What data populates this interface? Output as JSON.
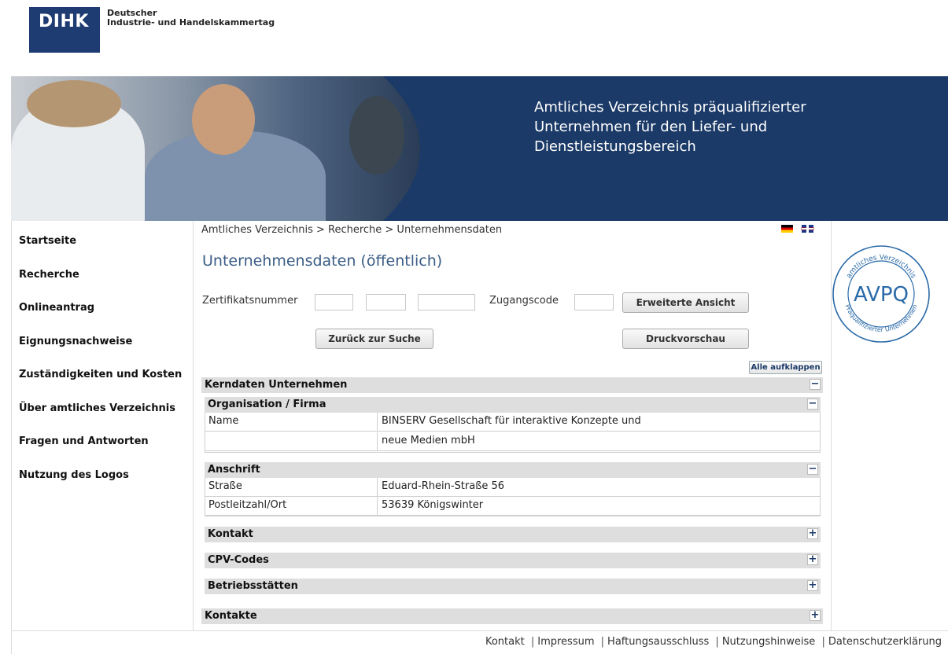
{
  "header": {
    "logo_text": "DIHK",
    "org_line1": "Deutscher",
    "org_line2": "Industrie- und Handelskammertag"
  },
  "banner": {
    "line1": "Amtliches Verzeichnis präqualifizierter",
    "line2": "Unternehmen für den Liefer- und",
    "line3": "Dienstleistungsbereich"
  },
  "nav": [
    {
      "label": "Startseite"
    },
    {
      "label": "Recherche"
    },
    {
      "label": "Onlineantrag"
    },
    {
      "label": "Eignungsnachweise"
    },
    {
      "label": "Zuständigkeiten und Kosten"
    },
    {
      "label": "Über amtliches Verzeichnis"
    },
    {
      "label": "Fragen und Antworten"
    },
    {
      "label": "Nutzung des Logos"
    }
  ],
  "breadcrumb": "Amtliches Verzeichnis > Recherche > Unternehmensdaten",
  "page_title": "Unternehmensdaten (öffentlich)",
  "form": {
    "cert_label": "Zertifikatsnummer",
    "access_label": "Zugangscode",
    "btn_extended": "Erweiterte Ansicht",
    "btn_back": "Zurück zur Suche",
    "btn_print": "Druckvorschau",
    "btn_expand_all": "Alle aufklappen"
  },
  "sections": {
    "kerndaten": "Kerndaten Unternehmen",
    "organisation": "Organisation / Firma",
    "anschrift": "Anschrift",
    "kontakt": "Kontakt",
    "cpv": "CPV-Codes",
    "betriebsstaetten": "Betriebsstätten",
    "kontakte": "Kontakte",
    "minus": "−",
    "plus": "+"
  },
  "organisation_rows": [
    {
      "key": "Name",
      "value": "BINSERV Gesellschaft für interaktive Konzepte und"
    },
    {
      "key": "",
      "value": "neue Medien mbH"
    }
  ],
  "anschrift_rows": [
    {
      "key": "Straße",
      "value": "Eduard-Rhein-Straße 56"
    },
    {
      "key": "Postleitzahl/Ort",
      "value": "53639 Königswinter"
    }
  ],
  "seal": {
    "top_text": "amtliches Verzeichnis",
    "center_text": "AVPQ",
    "bottom_text": "Präqualifizierter Unternehmen"
  },
  "footer": {
    "kontakt": "Kontakt",
    "impressum": "Impressum",
    "haftung": "Haftungsausschluss",
    "nutzung": "Nutzungshinweise",
    "datenschutz": "Datenschutzerklärung",
    "separator": "|"
  },
  "colors": {
    "banner": "#1b3a67",
    "title": "#3b5d85",
    "section_bg": "#dedede"
  }
}
